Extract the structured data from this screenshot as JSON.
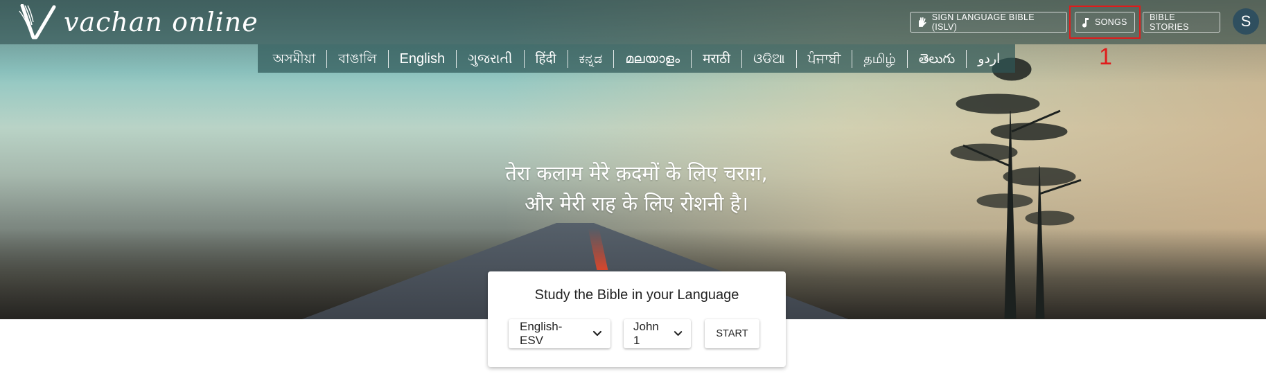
{
  "app": {
    "logo_text": "vachan online",
    "user_initial": "S"
  },
  "header": {
    "sign_language_label": "SIGN LANGUAGE BIBLE (ISLV)",
    "songs_label": "SONGS",
    "bible_stories_label": "BIBLE STORIES"
  },
  "annotation": {
    "number": "1",
    "color": "#e01b1b"
  },
  "languages": [
    {
      "label": "অসমীয়া"
    },
    {
      "label": "বাঙালি"
    },
    {
      "label": "English",
      "active": true
    },
    {
      "label": "ગુજરાતી"
    },
    {
      "label": "हिंदी"
    },
    {
      "label": "ಕನ್ನಡ"
    },
    {
      "label": "മലയാളം"
    },
    {
      "label": "मराठी"
    },
    {
      "label": "ଓଡିଆ"
    },
    {
      "label": "ਪੰਜਾਬੀ"
    },
    {
      "label": "தமிழ்"
    },
    {
      "label": "తెలుగు"
    },
    {
      "label": "اردو"
    }
  ],
  "hero": {
    "verse_line1": "तेरा कलाम मेरे क़दमों के लिए चराग़,",
    "verse_line2": "और मेरी राह के लिए रोशनी है।"
  },
  "study": {
    "title": "Study the Bible in your Language",
    "version_value": "English-ESV",
    "chapter_value": "John 1",
    "start_label": "START"
  },
  "icons": {
    "sign_language": "hand-sign-icon",
    "songs": "music-note-icon",
    "dropdown": "chevron-down-icon"
  }
}
